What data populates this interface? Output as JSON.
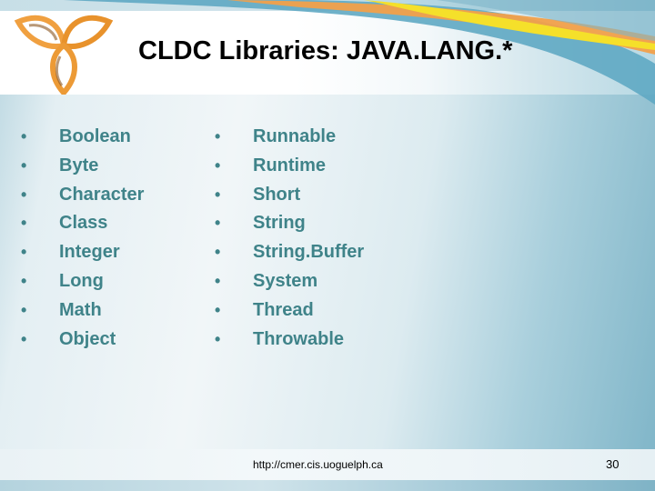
{
  "slide": {
    "title": "CLDC Libraries: JAVA.LANG.*",
    "logo": "trefoil-knot-logo-icon",
    "bullet_glyph": "•",
    "columns": [
      {
        "items": [
          "Boolean",
          "Byte",
          "Character",
          "Class",
          "Integer",
          "Long",
          "Math",
          "Object"
        ]
      },
      {
        "items": [
          "Runnable",
          "Runtime",
          "Short",
          "String",
          "String.Buffer",
          "System",
          "Thread",
          "Throwable"
        ]
      }
    ],
    "footer": {
      "url": "http://cmer.cis.uoguelph.ca",
      "page_number": "30"
    },
    "colors": {
      "title": "#000000",
      "list_text": "#3f8389",
      "logo_orange": "#f0a040",
      "swoosh_blue": "#5fa9c3",
      "swoosh_orange": "#f2a04a",
      "swoosh_yellow": "#f5e02a"
    }
  }
}
